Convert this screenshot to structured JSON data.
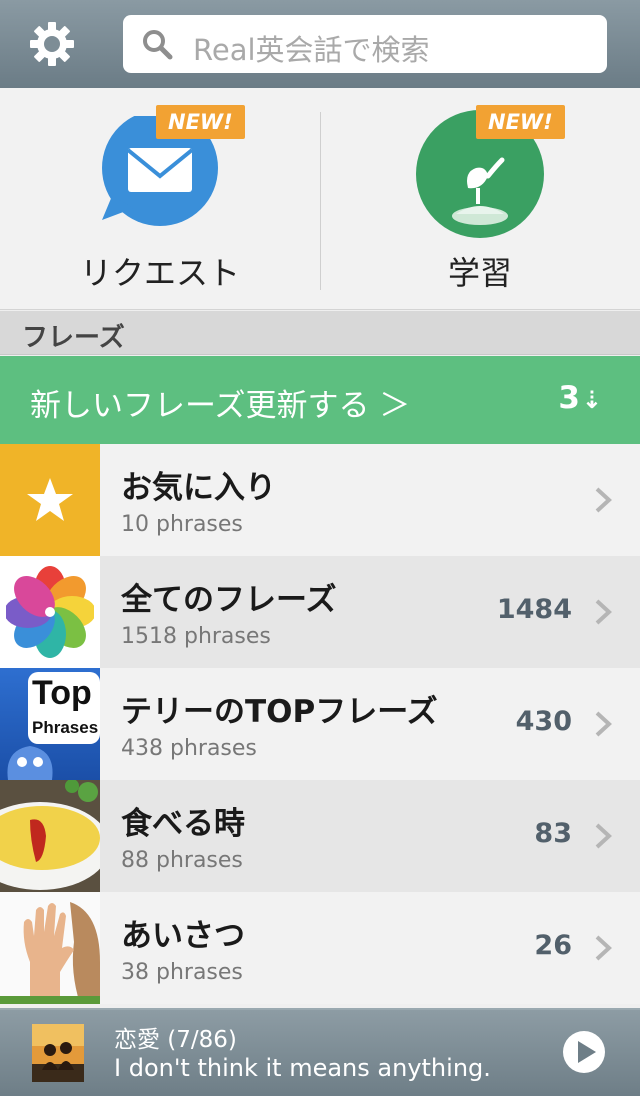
{
  "header": {
    "search_placeholder": "Real英会話で検索"
  },
  "features": {
    "request": {
      "label": "リクエスト",
      "badge": "NEW!"
    },
    "study": {
      "label": "学習",
      "badge": "NEW!"
    }
  },
  "section": {
    "title": "フレーズ"
  },
  "update_bar": {
    "text": "新しいフレーズ更新する ＞",
    "count": "3",
    "arrow": "⇣"
  },
  "list": [
    {
      "title": "お気に入り",
      "sub": "10 phrases",
      "num": ""
    },
    {
      "title": "全てのフレーズ",
      "sub": "1518 phrases",
      "num": "1484"
    },
    {
      "title": "テリーのTOPフレーズ",
      "sub": "438 phrases",
      "num": "430",
      "thumb_top": "Top",
      "thumb_bottom": "Phrases"
    },
    {
      "title": "食べる時",
      "sub": "88 phrases",
      "num": "83"
    },
    {
      "title": "あいさつ",
      "sub": "38 phrases",
      "num": "26"
    }
  ],
  "player": {
    "title": "恋愛 (7/86)",
    "phrase": "I don't think it means anything."
  },
  "colors": {
    "header": "#7d8d96",
    "accent_green": "#5dbf80",
    "badge_orange": "#f2a233",
    "mail_blue": "#3a8fd9",
    "study_green": "#3aa062",
    "star_yellow": "#f0b428"
  }
}
